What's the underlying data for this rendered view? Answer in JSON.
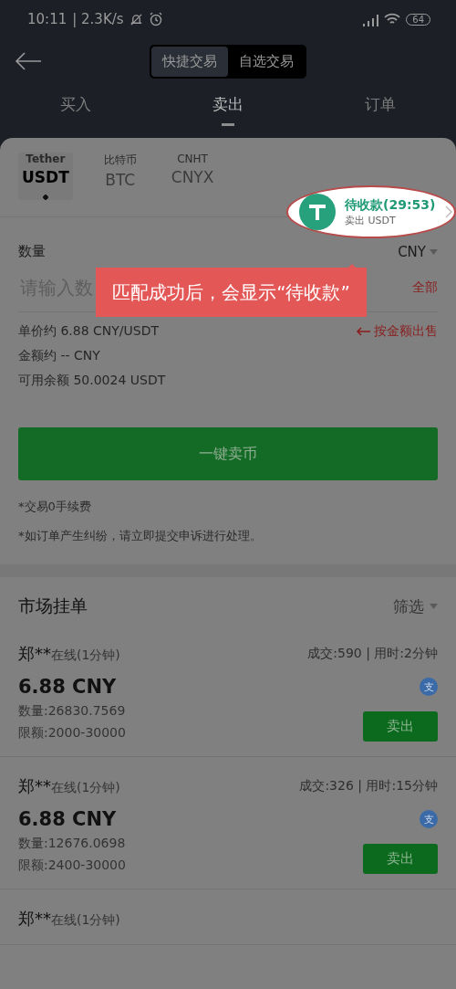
{
  "status_bar": {
    "time": "10:11",
    "speed": "| 2.3K/s",
    "battery": "64"
  },
  "mode_tabs": [
    {
      "label": "快捷交易",
      "selected": true
    },
    {
      "label": "自选交易",
      "selected": false
    }
  ],
  "tabs": [
    {
      "label": "买入",
      "selected": false
    },
    {
      "label": "卖出",
      "selected": true
    },
    {
      "label": "订单",
      "selected": false
    }
  ],
  "coins": [
    {
      "name": "Tether",
      "symbol": "USDT",
      "selected": true
    },
    {
      "name": "比特币",
      "symbol": "BTC",
      "selected": false
    },
    {
      "name": "CNHT",
      "symbol": "CNYX",
      "selected": false
    }
  ],
  "pending": {
    "title": "待收款(29:53)",
    "subtitle": "卖出 USDT"
  },
  "tooltip": "匹配成功后，会显示“待收款”",
  "form": {
    "quantity_label": "数量",
    "unit": "CNY",
    "placeholder": "请输入数",
    "all": "全部",
    "price": "单价约 6.88 CNY/USDT",
    "switch": "按金额出售",
    "amount": "金额约 -- CNY",
    "balance": "可用余额 50.0024 USDT",
    "submit": "一键卖币",
    "notes": [
      "*交易0手续费",
      "*如订单产生纠纷，请立即提交申诉进行处理。"
    ]
  },
  "market": {
    "title": "市场挂单",
    "filter": "筛选",
    "listings": [
      {
        "name": "郑**",
        "status": "在线(1分钟)",
        "stats": "成交:590 | 用时:2分钟",
        "price": "6.88 CNY",
        "payment": "支",
        "quantity": "数量:26830.7569",
        "limit": "限额:2000-30000",
        "action": "卖出"
      },
      {
        "name": "郑**",
        "status": "在线(1分钟)",
        "stats": "成交:326 | 用时:15分钟",
        "price": "6.88 CNY",
        "payment": "支",
        "quantity": "数量:12676.0698",
        "limit": "限额:2400-30000",
        "action": "卖出"
      },
      {
        "name": "郑**",
        "status": "在线(1分钟)"
      }
    ]
  }
}
